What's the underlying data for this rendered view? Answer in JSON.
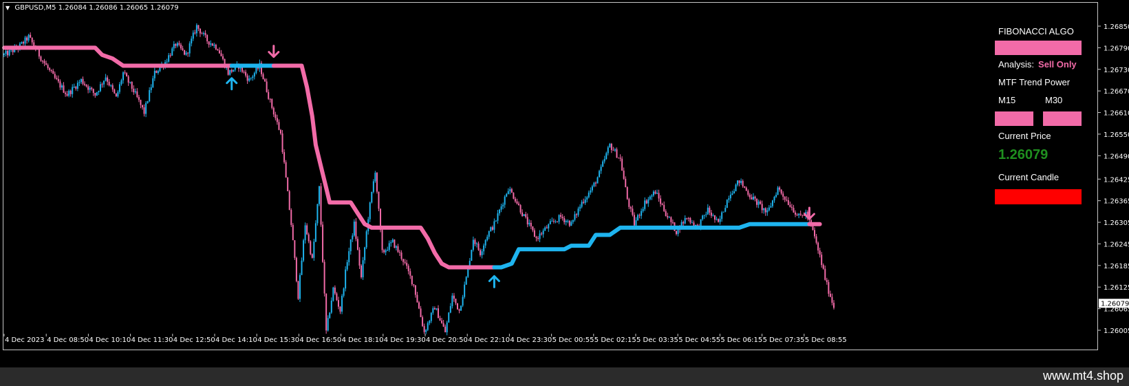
{
  "header": {
    "symbol": "GBPUSD,M5",
    "ohlc": "1.26084 1.26086 1.26065 1.26079"
  },
  "panel": {
    "title": "FIBONACCI ALGO",
    "title_box_color": "#f26ba8",
    "analysis_label": "Analysis:",
    "analysis_value": "Sell Only",
    "analysis_color": "#f26ba8",
    "mtf_label": "MTF Trend Power",
    "m15_label": "M15",
    "m30_label": "M30",
    "m15_color": "#f26ba8",
    "m30_color": "#f26ba8",
    "current_price_label": "Current Price",
    "current_price_value": "1.26079",
    "current_price_color": "#1f8f1f",
    "current_candle_label": "Current Candle",
    "current_candle_color": "#ff0000"
  },
  "watermark": "www.mt4.shop",
  "colors": {
    "bull": "#1eb4ef",
    "bear": "#f26ba8",
    "background": "#000000",
    "axis_text": "#ffffff"
  },
  "chart_data": {
    "type": "candlestick",
    "symbol": "GBPUSD",
    "timeframe": "M5",
    "x_labels": [
      "4 Dec 2023",
      "4 Dec 08:50",
      "4 Dec 10:10",
      "4 Dec 11:30",
      "4 Dec 12:50",
      "4 Dec 14:10",
      "4 Dec 15:30",
      "4 Dec 16:50",
      "4 Dec 18:10",
      "4 Dec 19:30",
      "4 Dec 20:50",
      "4 Dec 22:10",
      "4 Dec 23:30",
      "5 Dec 00:55",
      "5 Dec 02:15",
      "5 Dec 03:35",
      "5 Dec 04:55",
      "5 Dec 06:15",
      "5 Dec 07:35",
      "5 Dec 08:55"
    ],
    "y_ticks": [
      "1.26850",
      "1.26790",
      "1.26730",
      "1.26670",
      "1.26610",
      "1.26550",
      "1.26490",
      "1.26425",
      "1.26365",
      "1.26305",
      "1.26245",
      "1.26185",
      "1.26125",
      "1.26065",
      "1.26005"
    ],
    "ylim": [
      1.2599,
      1.2687
    ],
    "bars_count": 300,
    "current_price": "1.26079",
    "close_path": [
      [
        0,
        1.2677
      ],
      [
        8,
        1.2679
      ],
      [
        14,
        1.2682
      ],
      [
        20,
        1.2677
      ],
      [
        28,
        1.2671
      ],
      [
        36,
        1.2666
      ],
      [
        44,
        1.267
      ],
      [
        52,
        1.2666
      ],
      [
        58,
        1.2671
      ],
      [
        64,
        1.2665
      ],
      [
        68,
        1.2672
      ],
      [
        74,
        1.2667
      ],
      [
        80,
        1.2661
      ],
      [
        86,
        1.2672
      ],
      [
        92,
        1.2675
      ],
      [
        98,
        1.268
      ],
      [
        104,
        1.2677
      ],
      [
        110,
        1.2685
      ],
      [
        116,
        1.2681
      ],
      [
        122,
        1.2679
      ],
      [
        128,
        1.2672
      ],
      [
        134,
        1.2674
      ],
      [
        140,
        1.267
      ],
      [
        146,
        1.2674
      ],
      [
        152,
        1.2664
      ],
      [
        158,
        1.2655
      ],
      [
        164,
        1.263
      ],
      [
        168,
        1.261
      ],
      [
        172,
        1.263
      ],
      [
        176,
        1.262
      ],
      [
        180,
        1.264
      ],
      [
        184,
        1.26
      ],
      [
        188,
        1.2612
      ],
      [
        192,
        1.2606
      ],
      [
        196,
        1.262
      ],
      [
        200,
        1.263
      ],
      [
        204,
        1.2615
      ],
      [
        208,
        1.2632
      ],
      [
        212,
        1.2645
      ],
      [
        216,
        1.2622
      ],
      [
        222,
        1.2625
      ],
      [
        228,
        1.262
      ],
      [
        234,
        1.2613
      ],
      [
        240,
        1.26
      ],
      [
        246,
        1.2607
      ],
      [
        252,
        1.26
      ],
      [
        256,
        1.261
      ],
      [
        260,
        1.2606
      ],
      [
        264,
        1.2615
      ],
      [
        268,
        1.2626
      ],
      [
        272,
        1.2622
      ],
      [
        276,
        1.2627
      ],
      [
        280,
        1.263
      ],
      [
        284,
        1.2635
      ],
      [
        288,
        1.264
      ],
      [
        292,
        1.2637
      ],
      [
        296,
        1.2633
      ],
      [
        304,
        1.2626
      ],
      [
        308,
        1.2628
      ],
      [
        312,
        1.263
      ],
      [
        318,
        1.2632
      ],
      [
        324,
        1.263
      ],
      [
        330,
        1.2636
      ],
      [
        336,
        1.264
      ],
      [
        340,
        1.2644
      ],
      [
        346,
        1.2652
      ],
      [
        352,
        1.2648
      ],
      [
        356,
        1.2637
      ],
      [
        360,
        1.263
      ],
      [
        366,
        1.2636
      ],
      [
        372,
        1.2639
      ],
      [
        378,
        1.2633
      ],
      [
        384,
        1.2628
      ],
      [
        390,
        1.2632
      ],
      [
        396,
        1.2629
      ],
      [
        402,
        1.2634
      ],
      [
        408,
        1.263
      ],
      [
        414,
        1.2638
      ],
      [
        420,
        1.2642
      ],
      [
        426,
        1.2638
      ],
      [
        432,
        1.2635
      ],
      [
        436,
        1.2633
      ],
      [
        442,
        1.264
      ],
      [
        448,
        1.2636
      ],
      [
        454,
        1.2632
      ],
      [
        458,
        1.2633
      ],
      [
        462,
        1.2628
      ],
      [
        466,
        1.2621
      ],
      [
        470,
        1.2613
      ],
      [
        474,
        1.2607
      ]
    ],
    "signal_line": [
      {
        "segment": 1,
        "color": "bear",
        "points": [
          [
            0,
            1.2679
          ],
          [
            52,
            1.2679
          ],
          [
            56,
            1.2677
          ],
          [
            62,
            1.2676
          ],
          [
            68,
            1.2674
          ],
          [
            92,
            1.2674
          ],
          [
            130,
            1.2674
          ]
        ]
      },
      {
        "segment": 2,
        "color": "bull",
        "points": [
          [
            130,
            1.2674
          ],
          [
            154,
            1.2674
          ]
        ]
      },
      {
        "segment": 3,
        "color": "bear",
        "points": [
          [
            154,
            1.2674
          ],
          [
            170,
            1.2674
          ],
          [
            173,
            1.2668
          ],
          [
            176,
            1.266
          ],
          [
            178,
            1.2652
          ],
          [
            181,
            1.2646
          ],
          [
            184,
            1.264
          ],
          [
            186,
            1.2636
          ],
          [
            198,
            1.2636
          ],
          [
            202,
            1.2633
          ],
          [
            206,
            1.263
          ],
          [
            210,
            1.2629
          ],
          [
            238,
            1.2629
          ],
          [
            242,
            1.2626
          ],
          [
            246,
            1.2622
          ],
          [
            250,
            1.2619
          ],
          [
            254,
            1.2618
          ],
          [
            280,
            1.2618
          ]
        ]
      },
      {
        "segment": 4,
        "color": "bull",
        "points": [
          [
            280,
            1.2618
          ],
          [
            284,
            1.2618
          ],
          [
            290,
            1.2619
          ],
          [
            294,
            1.2623
          ],
          [
            306,
            1.2623
          ],
          [
            320,
            1.2623
          ],
          [
            324,
            1.2624
          ],
          [
            334,
            1.2624
          ],
          [
            338,
            1.2627
          ],
          [
            346,
            1.2627
          ],
          [
            352,
            1.2629
          ],
          [
            420,
            1.2629
          ],
          [
            426,
            1.263
          ],
          [
            460,
            1.263
          ]
        ]
      },
      {
        "segment": 5,
        "color": "bear",
        "points": [
          [
            460,
            1.263
          ],
          [
            466,
            1.263
          ]
        ]
      }
    ],
    "arrows": [
      {
        "type": "sell",
        "bar": 154,
        "price": 1.2678
      },
      {
        "type": "buy",
        "bar": 130,
        "price": 1.2669
      },
      {
        "type": "buy",
        "bar": 280,
        "price": 1.2614
      },
      {
        "type": "sell",
        "bar": 460,
        "price": 1.2633
      }
    ]
  }
}
